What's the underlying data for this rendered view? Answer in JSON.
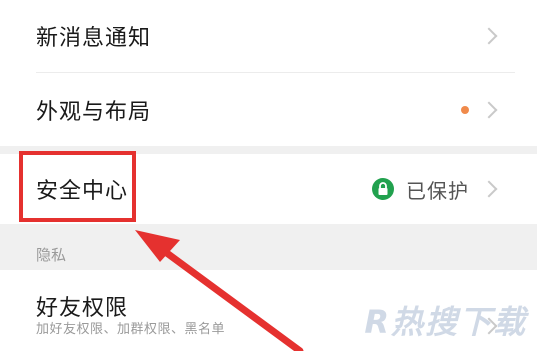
{
  "settings": {
    "rows": {
      "notifications": {
        "label": "新消息通知"
      },
      "appearance": {
        "label": "外观与布局"
      },
      "security": {
        "label": "安全中心",
        "status": "已保护"
      }
    },
    "privacy_section": {
      "header": "隐私",
      "friends_permission": {
        "label": "好友权限",
        "description": "加好友权限、加群权限、黑名单"
      }
    }
  },
  "annotation": {
    "highlight_color": "#e5312f",
    "arrow_color": "#e5312f"
  },
  "watermark": {
    "text": "R热搜下载"
  },
  "colors": {
    "notification_dot": "#f08a4b",
    "shield_badge": "#21a14e"
  },
  "icons": [
    "chevron-right-icon",
    "lock-icon"
  ]
}
